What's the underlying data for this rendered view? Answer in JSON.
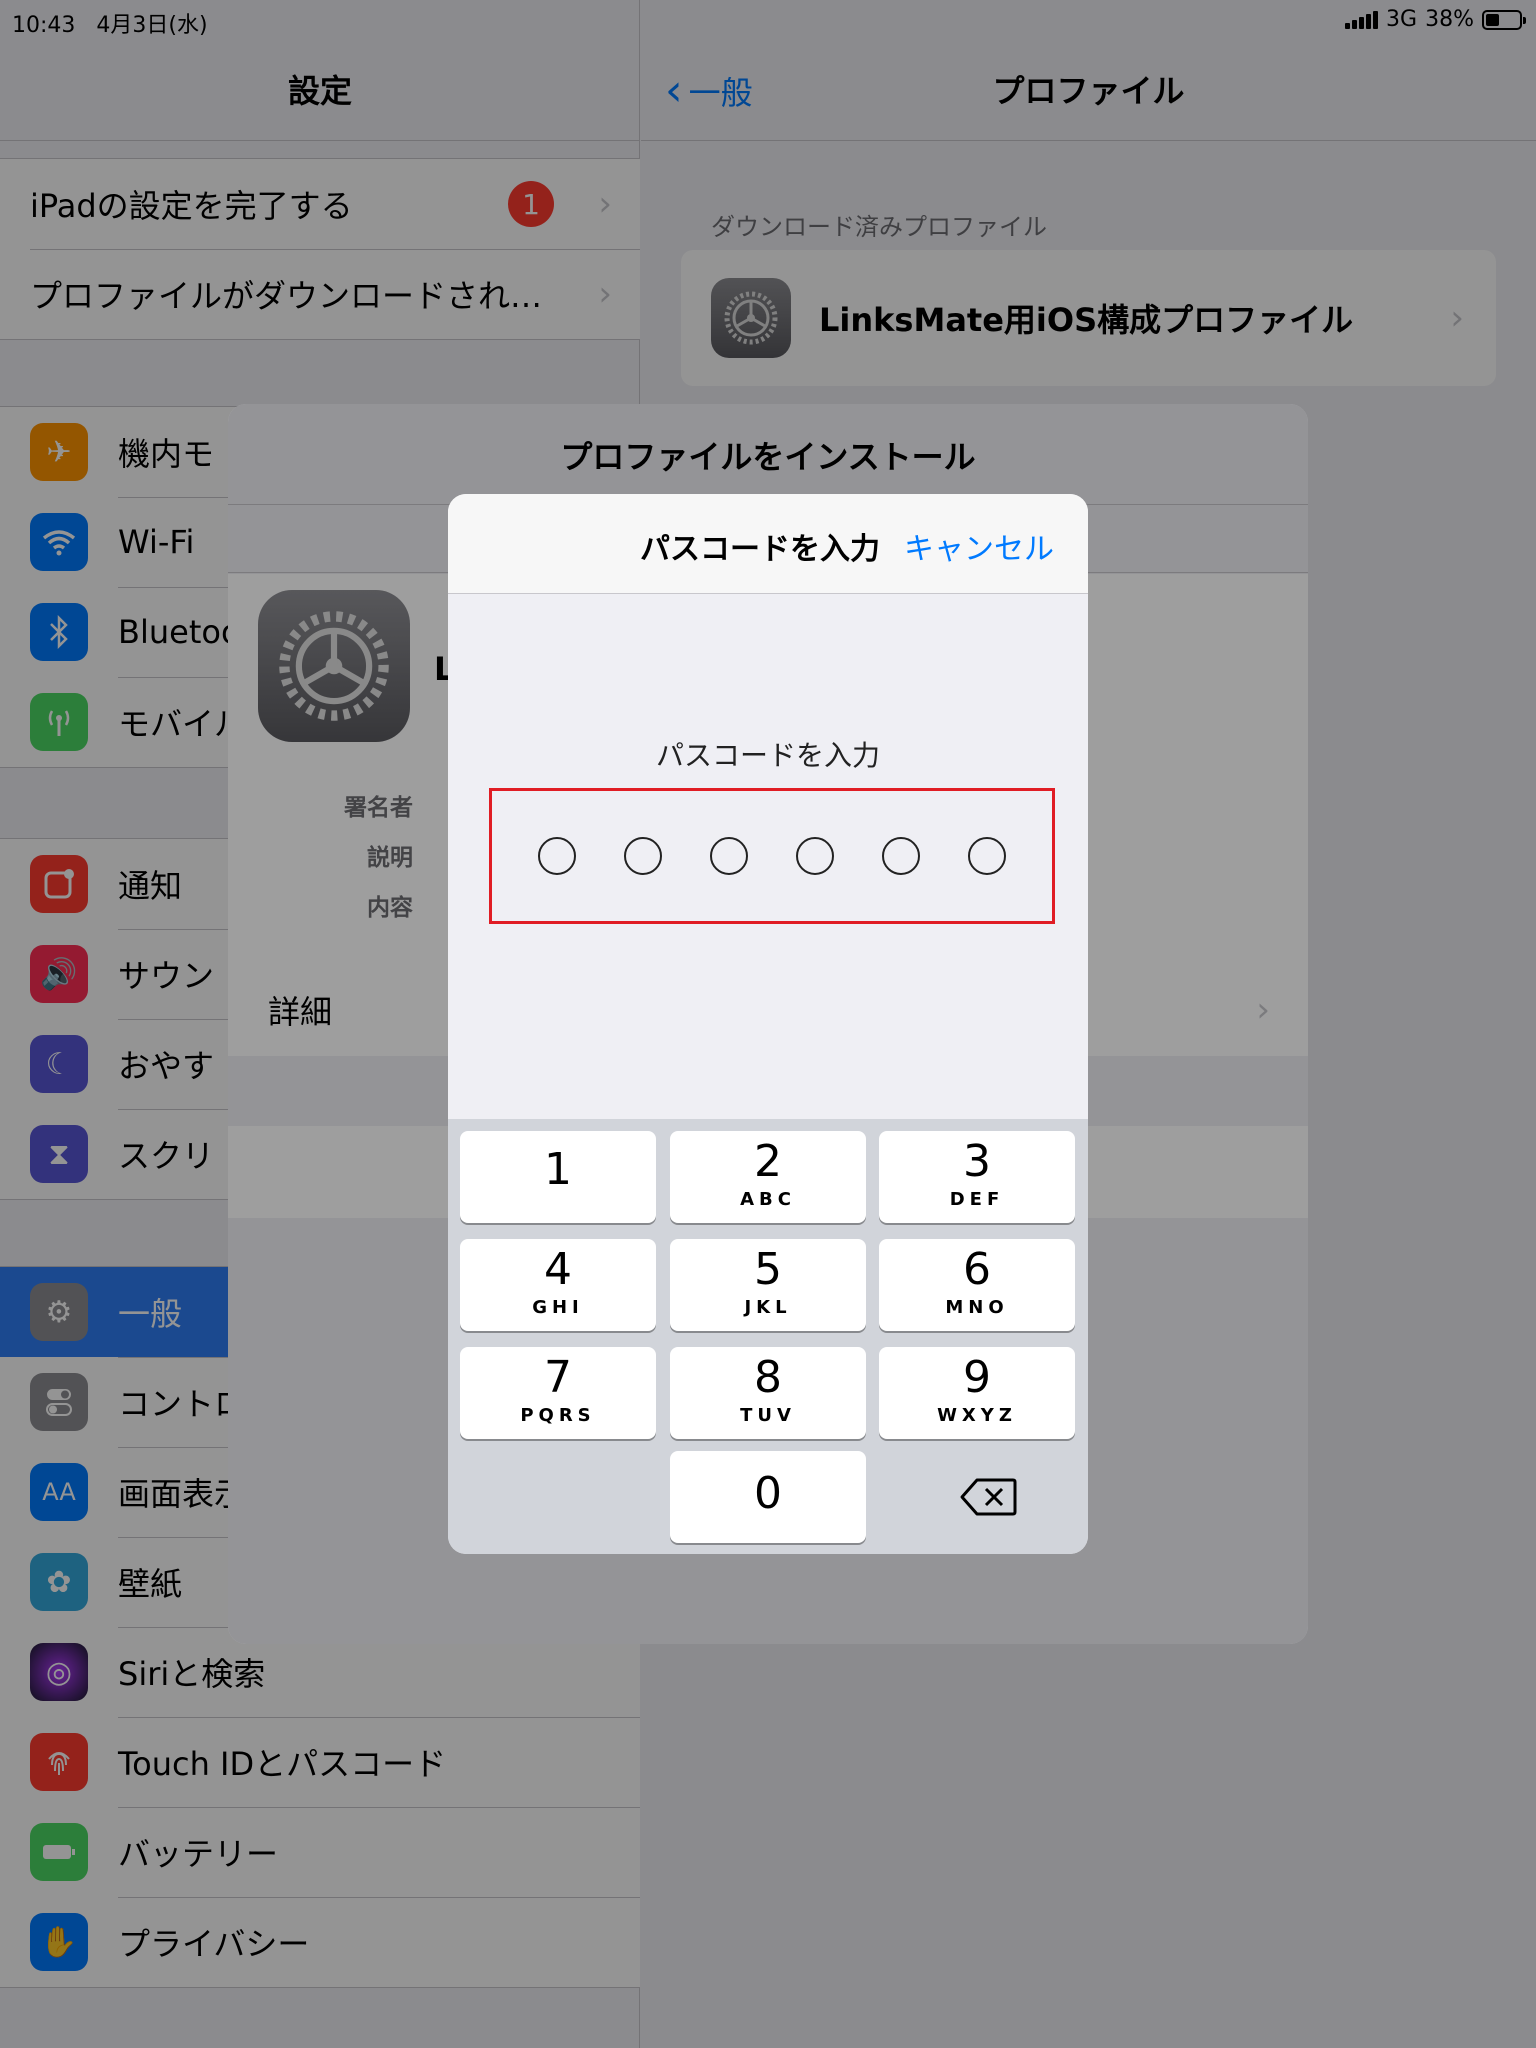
{
  "status_bar": {
    "time": "10:43",
    "date": "4月3日(水)",
    "network": "3G",
    "battery": "38%"
  },
  "left_pane": {
    "title": "設定",
    "top_group": [
      {
        "label": "iPadの設定を完了する",
        "badge": "1"
      },
      {
        "label": "プロファイルがダウンロードされ…"
      }
    ],
    "group1": [
      {
        "label": "機内モ",
        "icon": "airplane-icon",
        "color": "#ff9500"
      },
      {
        "label": "Wi-Fi",
        "icon": "wifi-icon",
        "color": "#007aff"
      },
      {
        "label": "Bluetoo",
        "icon": "bluetooth-icon",
        "color": "#007aff"
      },
      {
        "label": "モバイル",
        "icon": "antenna-icon",
        "color": "#4cd964"
      }
    ],
    "group2": [
      {
        "label": "通知",
        "icon": "notification-icon",
        "color": "#ff3b30"
      },
      {
        "label": "サウン",
        "icon": "speaker-icon",
        "color": "#ff2d55"
      },
      {
        "label": "おやす",
        "icon": "moon-icon",
        "color": "#5856d6"
      },
      {
        "label": "スクリ",
        "icon": "hourglass-icon",
        "color": "#5856d6"
      }
    ],
    "group3": [
      {
        "label": "一般",
        "icon": "gear-icon",
        "color": "#8e8e93"
      },
      {
        "label": "コントロ",
        "icon": "toggle-icon",
        "color": "#8e8e93"
      },
      {
        "label": "画面表示",
        "icon": "text-size-icon",
        "color": "#007aff"
      },
      {
        "label": "壁紙",
        "icon": "flower-icon",
        "color": "#34aadc"
      },
      {
        "label": "Siriと検索",
        "icon": "siri-icon",
        "color": "#222"
      },
      {
        "label": "Touch IDとパスコード",
        "icon": "fingerprint-icon",
        "color": "#ff3b30"
      },
      {
        "label": "バッテリー",
        "icon": "battery-icon",
        "color": "#4cd964"
      },
      {
        "label": "プライバシー",
        "icon": "hand-icon",
        "color": "#007aff"
      }
    ]
  },
  "right_pane": {
    "back_label": "一般",
    "title": "プロファイル",
    "section_header": "ダウンロード済みプロファイル",
    "profile_name": "LinksMate用iOS構成プロファイル"
  },
  "install_sheet": {
    "title": "プロファイルをインストール",
    "name_initial": "L",
    "info_labels": [
      "署名者",
      "説明",
      "内容"
    ],
    "detail_label": "詳細"
  },
  "passcode": {
    "title": "パスコードを入力",
    "cancel": "キャンセル",
    "prompt": "パスコードを入力",
    "digit_count": 6,
    "highlight_color": "#e01c24",
    "keys": [
      {
        "num": "1",
        "letters": ""
      },
      {
        "num": "2",
        "letters": "ABC"
      },
      {
        "num": "3",
        "letters": "DEF"
      },
      {
        "num": "4",
        "letters": "GHI"
      },
      {
        "num": "5",
        "letters": "JKL"
      },
      {
        "num": "6",
        "letters": "MNO"
      },
      {
        "num": "7",
        "letters": "PQRS"
      },
      {
        "num": "8",
        "letters": "TUV"
      },
      {
        "num": "9",
        "letters": "WXYZ"
      },
      {
        "num": "0",
        "letters": ""
      }
    ]
  }
}
